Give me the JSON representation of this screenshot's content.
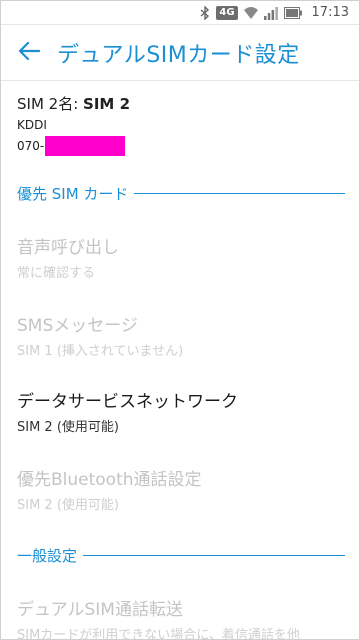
{
  "status_bar": {
    "network_badge": "4G",
    "time": "17:13",
    "icons": [
      "bluetooth-icon",
      "signal-icon",
      "wifi-icon",
      "battery-icon"
    ]
  },
  "toolbar": {
    "title": "デュアルSIMカード設定",
    "back_icon": "back-arrow-icon"
  },
  "sim_info": {
    "name_label": "SIM 2名: ",
    "name_value": "SIM 2",
    "carrier": "KDDI",
    "number_prefix": "070-"
  },
  "sections": {
    "preferred_sim": "優先 SIM カード",
    "general": "一般設定"
  },
  "prefs": {
    "voice_call": {
      "title": "音声呼び出し",
      "summary": "常に確認する",
      "enabled": false
    },
    "sms": {
      "title": "SMSメッセージ",
      "summary": "SIM 1 (挿入されていません)",
      "enabled": false
    },
    "data_network": {
      "title": "データサービスネットワーク",
      "summary": "SIM 2 (使用可能)",
      "enabled": true
    },
    "bluetooth_call": {
      "title": "優先Bluetooth通話設定",
      "summary": "SIM 2 (使用可能)",
      "enabled": false
    },
    "call_forward": {
      "title": "デュアルSIM通話転送",
      "summary": "SIMカードが利用できない場合に、着信通話を他",
      "enabled": false
    }
  },
  "colors": {
    "accent": "#1a8fd4",
    "disabled_text": "#c4c4c4",
    "mask": "#ff00cc"
  }
}
